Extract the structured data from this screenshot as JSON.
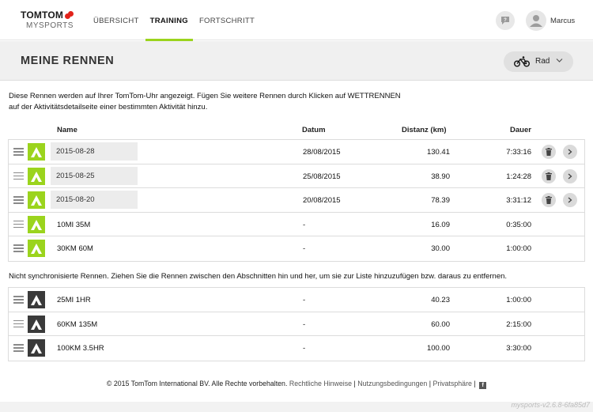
{
  "brand": {
    "top": "TOMTOM",
    "bottom": "MYSPORTS"
  },
  "nav": [
    {
      "label": "ÜBERSICHT",
      "active": false
    },
    {
      "label": "TRAINING",
      "active": true
    },
    {
      "label": "FORTSCHRITT",
      "active": false
    }
  ],
  "user": {
    "name": "Marcus"
  },
  "page": {
    "title": "MEINE RENNEN"
  },
  "sport_select": {
    "value": "Rad",
    "icon": "bicycle-icon"
  },
  "intro": "Diese Rennen werden auf Ihrer TomTom-Uhr angezeigt. Fügen Sie weitere Rennen durch Klicken auf WETTRENNEN auf der Aktivitätsdetailseite einer bestimmten Aktivität hinzu.",
  "table": {
    "headers": {
      "name": "Name",
      "date": "Datum",
      "distance": "Distanz (km)",
      "duration": "Dauer"
    }
  },
  "synced": [
    {
      "name": "2015-08-28",
      "date": "28/08/2015",
      "distance": "130.41",
      "duration": "7:33:16"
    },
    {
      "name": "2015-08-25",
      "date": "25/08/2015",
      "distance": "38.90",
      "duration": "1:24:28"
    },
    {
      "name": "2015-08-20",
      "date": "20/08/2015",
      "distance": "78.39",
      "duration": "3:31:12"
    },
    {
      "name": "10MI 35M",
      "date": "-",
      "distance": "16.09",
      "duration": "0:35:00"
    },
    {
      "name": "30KM 60M",
      "date": "-",
      "distance": "30.00",
      "duration": "1:00:00"
    }
  ],
  "unsync_text": "Nicht synchronisierte Rennen. Ziehen Sie die Rennen zwischen den Abschnitten hin und her, um sie zur Liste hinzuzufügen bzw. daraus zu entfernen.",
  "unsynced": [
    {
      "name": "25MI 1HR",
      "date": "-",
      "distance": "40.23",
      "duration": "1:00:00"
    },
    {
      "name": "60KM 135M",
      "date": "-",
      "distance": "60.00",
      "duration": "2:15:00"
    },
    {
      "name": "100KM 3.5HR",
      "date": "-",
      "distance": "100.00",
      "duration": "3:30:00"
    }
  ],
  "footer": {
    "copyright": "© 2015 TomTom International BV. Alle Rechte vorbehalten.",
    "links": [
      "Rechtliche Hinweise",
      "Nutzungsbedingungen",
      "Privatsphäre"
    ],
    "separator": "|",
    "facebook": "f"
  },
  "version": "mysports-v2.6.8-6fa85d7",
  "colors": {
    "accent": "#9bd41d",
    "dark_icon": "#3a3a3a"
  }
}
